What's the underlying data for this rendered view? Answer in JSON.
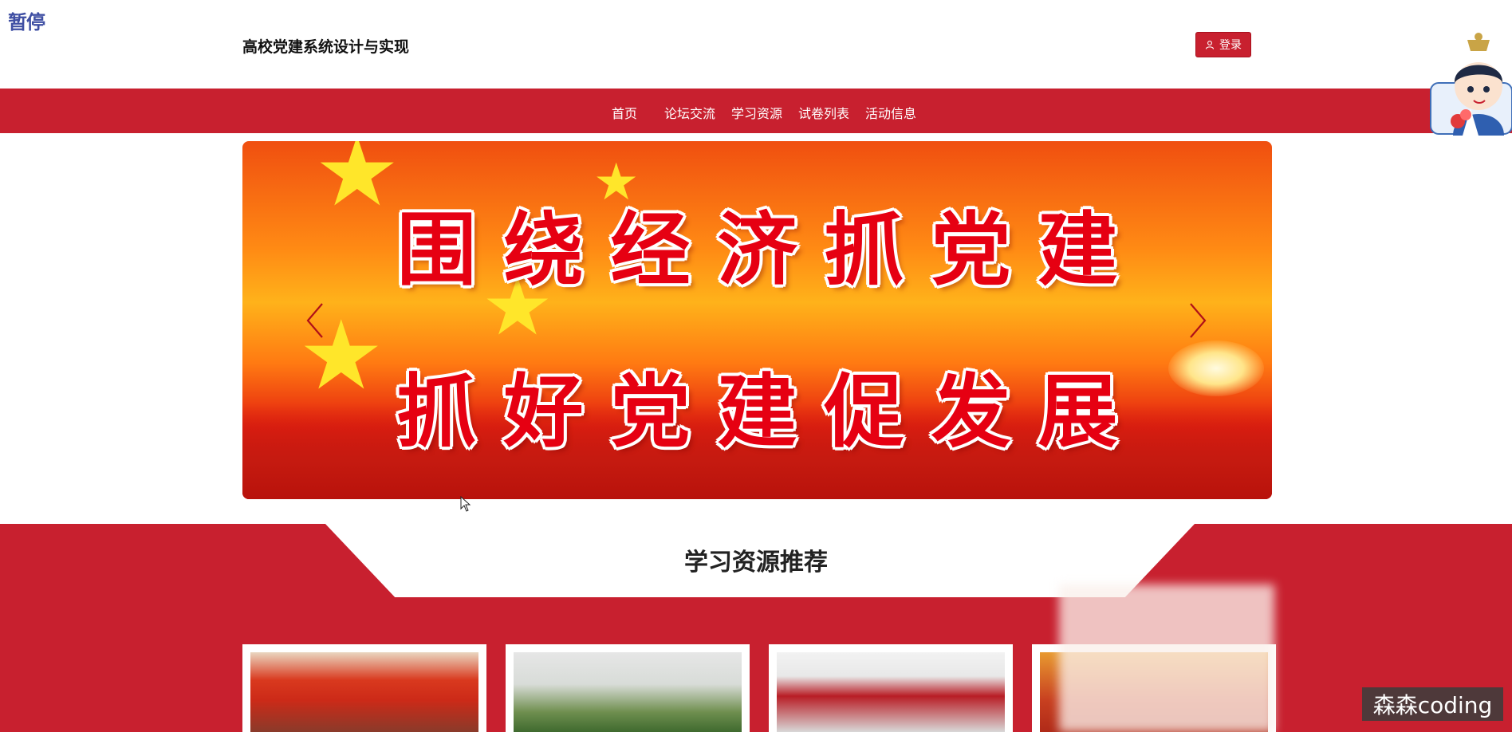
{
  "overlay": {
    "pause_label": "暂停"
  },
  "header": {
    "site_title": "高校党建系统设计与实现",
    "login_label": "登录"
  },
  "nav": {
    "items": [
      "首页",
      "论坛交流",
      "学习资源",
      "试卷列表",
      "活动信息"
    ]
  },
  "banner": {
    "line1": "围绕经济抓党建",
    "line2": "抓好党建促发展"
  },
  "section": {
    "title": "学习资源推荐"
  },
  "watermark": {
    "text": "森森coding"
  },
  "colors": {
    "primary_red": "#c8202f",
    "banner_text_red": "#e60012",
    "star_yellow": "#ffe62a"
  }
}
